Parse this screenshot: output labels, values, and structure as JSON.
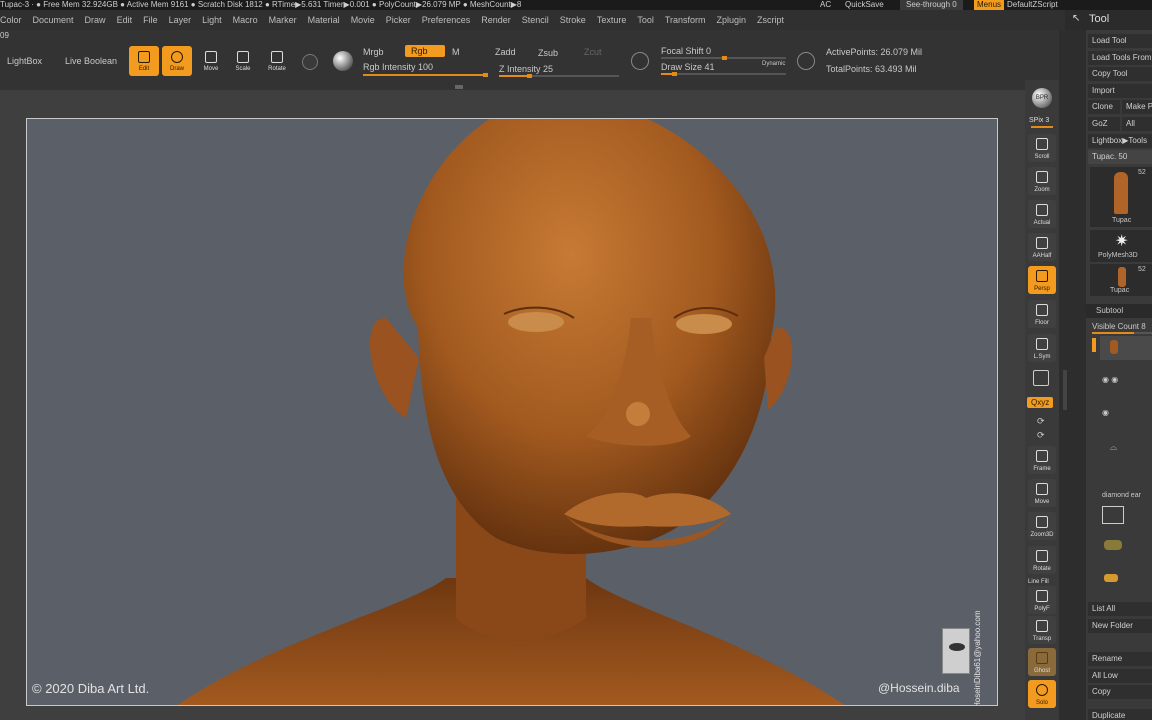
{
  "title_bar": {
    "status": "Tupac-3  ·  ● Free Mem 32.924GB ● Active Mem 9161 ● Scratch Disk 1812 ● RTime▶5.631 Timer▶0.001 ● PolyCount▶26.079 MP ● MeshCount▶8",
    "ac": "AC",
    "quicksave": "QuickSave",
    "see_through": "See-through  0",
    "menus": "Menus",
    "script": "DefaultZScript"
  },
  "menus": [
    "Color",
    "Document",
    "Draw",
    "Edit",
    "File",
    "Layer",
    "Light",
    "Macro",
    "Marker",
    "Material",
    "Movie",
    "Picker",
    "Preferences",
    "Render",
    "Stencil",
    "Stroke",
    "Texture",
    "Tool",
    "Transform",
    "Zplugin",
    "Zscript"
  ],
  "version": "09",
  "toolbar": {
    "lightbox": "LightBox",
    "live_boolean": "Live Boolean",
    "edit": "Edit",
    "draw": "Draw",
    "move": "Move",
    "scale": "Scale",
    "rotate": "Rotate",
    "mrgb": "Mrgb",
    "rgb": "Rgb",
    "m": "M",
    "rgb_intensity": "Rgb Intensity 100",
    "zadd": "Zadd",
    "zsub": "Zsub",
    "zcut": "Zcut",
    "z_intensity": "Z Intensity 25",
    "focal_shift": "Focal Shift 0",
    "draw_size": "Draw Size 41",
    "dynamic": "Dynamic",
    "active_points": "ActivePoints: 26.079 Mil",
    "total_points": "TotalPoints: 63.493 Mil",
    "rgb_intensity_level": 1.0,
    "z_intensity_level": 0.25,
    "focal_shift_level": 0.5,
    "draw_size_level": 0.1
  },
  "canvas": {
    "copyright": "© 2020  Diba Art Ltd.",
    "handle": "@Hossein.diba",
    "email": "HoseinDiba61@yahoo.com"
  },
  "right_shelf": {
    "bpr": "BPR",
    "spix": "SPix 3",
    "scroll": "Scroll",
    "zoom": "Zoom",
    "actual": "Actual",
    "aahalf": "AAHalf",
    "persp": "Persp",
    "floor": "Floor",
    "lsym": "L.Sym",
    "qxyz": "Qxyz",
    "frame": "Frame",
    "move": "Move",
    "zoom3d": "Zoom3D",
    "rotate": "Rotate",
    "line_fill": "Line Fill",
    "polyf": "PolyF",
    "transp": "Transp",
    "ghost": "Ghost",
    "solo": "Solo"
  },
  "tool_panel": {
    "title": "Tool",
    "load_tool": "Load Tool",
    "load_tools_from": "Load Tools From",
    "copy_tool": "Copy Tool",
    "import": "Import",
    "clone": "Clone",
    "make": "Make P",
    "goz": "GoZ",
    "all": "All",
    "lightbox_tools": "Lightbox▶Tools",
    "tupac": "Tupac. 50",
    "thumb1_label": "Tupac",
    "thumb1_count": "52",
    "polymesh": "PolyMesh3D",
    "thumb3_label": "Tupac",
    "thumb3_count": "52",
    "subtool": "Subtool",
    "visible_count": "Visible Count 8",
    "diamond": "diamond ear",
    "list_all": "List All",
    "new_folder": "New Folder",
    "rename": "Rename",
    "all_low": "All Low",
    "copy": "Copy",
    "duplicate": "Duplicate"
  },
  "colors": {
    "accent": "#f39b1f",
    "skin": "#b86c2a",
    "canvas": "#5b5f68"
  }
}
